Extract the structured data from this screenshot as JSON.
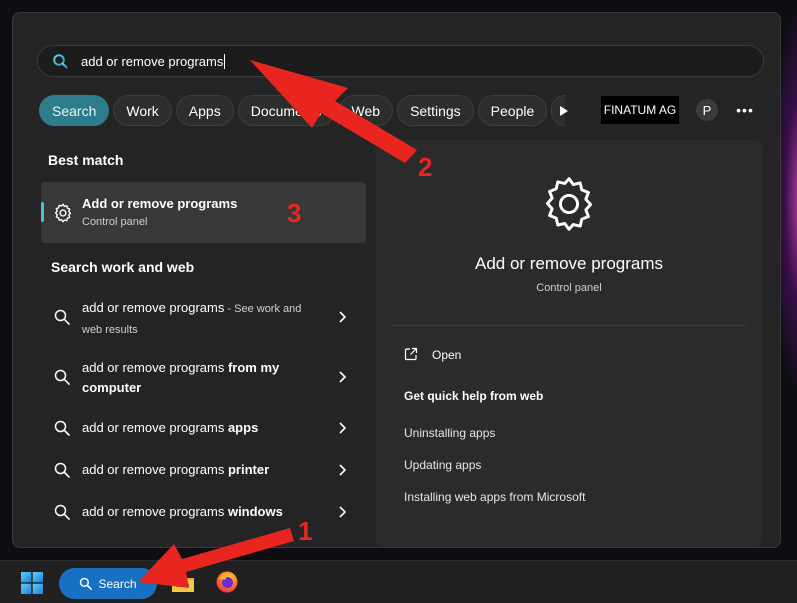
{
  "search": {
    "query": "add or remove programs"
  },
  "tabs": [
    {
      "label": "Search",
      "active": true
    },
    {
      "label": "Work"
    },
    {
      "label": "Apps"
    },
    {
      "label": "Documents"
    },
    {
      "label": "Web"
    },
    {
      "label": "Settings"
    },
    {
      "label": "People"
    }
  ],
  "toolbar": {
    "org_name": "FINATUM AG",
    "avatar_initial": "P",
    "more_label": "•••"
  },
  "best_match": {
    "heading": "Best match",
    "title": "Add or remove programs",
    "subtitle": "Control panel"
  },
  "web": {
    "heading": "Search work and web",
    "results": [
      {
        "prefix": "add or remove programs",
        "bold": "",
        "suffix": " - See work and web results"
      },
      {
        "prefix": "add or remove programs ",
        "bold": "from my computer",
        "suffix": ""
      },
      {
        "prefix": "add or remove programs ",
        "bold": "apps",
        "suffix": ""
      },
      {
        "prefix": "add or remove programs ",
        "bold": "printer",
        "suffix": ""
      },
      {
        "prefix": "add or remove programs ",
        "bold": "windows",
        "suffix": ""
      }
    ]
  },
  "preview": {
    "title": "Add or remove programs",
    "subtitle": "Control panel",
    "open_label": "Open",
    "help_title": "Get quick help from web",
    "help_links": [
      "Uninstalling apps",
      "Updating apps",
      "Installing web apps from Microsoft"
    ]
  },
  "taskbar": {
    "search_label": "Search"
  },
  "annotations": {
    "step1": "1",
    "step2": "2",
    "step3": "3",
    "color": "#e8251e"
  },
  "icons": {
    "search": "search-icon",
    "gear": "gear-icon",
    "chevron": "chevron-right-icon",
    "open": "open-external-icon",
    "play": "play-icon",
    "start": "windows-start-icon",
    "explorer": "file-explorer-icon",
    "browser": "firefox-icon"
  }
}
